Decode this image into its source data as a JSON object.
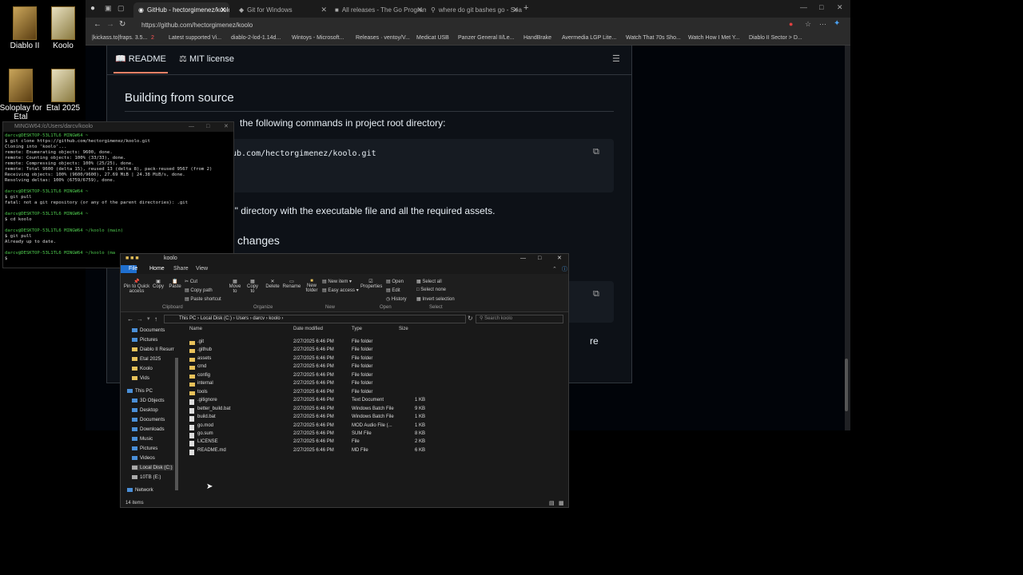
{
  "desktop": {
    "icons": [
      {
        "label": "Diablo II"
      },
      {
        "label": "Koolo"
      },
      {
        "label": "Soloplay for Etal"
      },
      {
        "label": "Etal 2025"
      }
    ]
  },
  "browser": {
    "tabs": [
      {
        "label": "GitHub - hectorgimenez/koolo: D"
      },
      {
        "label": "Git for Windows"
      },
      {
        "label": "All releases - The Go Programmi"
      },
      {
        "label": "where do git bashes go - Search"
      }
    ],
    "url": "https://github.com/hectorgimenez/koolo",
    "bookmarks": [
      {
        "label": "|kickass.to|fraps. 3.5..."
      },
      {
        "label": "2"
      },
      {
        "label": "Latest supported Vi..."
      },
      {
        "label": "diablo-2-lod-1.14d..."
      },
      {
        "label": "Wintoys - Microsoft..."
      },
      {
        "label": "Releases · ventoy/V..."
      },
      {
        "label": "Medicat USB"
      },
      {
        "label": "Panzer General II/Le..."
      },
      {
        "label": "HandBrake"
      },
      {
        "label": "Avermedia LGP Lite..."
      },
      {
        "label": "Watch That 70s Sho..."
      },
      {
        "label": "Watch How I Met Y..."
      },
      {
        "label": "Diablo II Sector > D..."
      }
    ],
    "readme_tab": "README",
    "license_tab": "MIT license",
    "heading1": "Building from source",
    "para1": "the following commands in project root directory:",
    "code1": "ub.com/hectorgimenez/koolo.git",
    "para2": "d\" directory with the executable file and all the required assets.",
    "heading2": "changes",
    "para3": "re"
  },
  "terminal": {
    "title": "MINGW64:/c/Users/darcv/koolo",
    "lines": [
      {
        "cls": "g",
        "text": "darcv@DESKTOP-53L1TL6 MINGW64 ~"
      },
      {
        "cls": "",
        "text": "$ git clone https://github.com/hectorgimenez/koolo.git"
      },
      {
        "cls": "",
        "text": "Cloning into 'koolo'..."
      },
      {
        "cls": "",
        "text": "remote: Enumerating objects: 9600, done."
      },
      {
        "cls": "",
        "text": "remote: Counting objects: 100% (33/33), done."
      },
      {
        "cls": "",
        "text": "remote: Compressing objects: 100% (25/25), done."
      },
      {
        "cls": "",
        "text": "remote: Total 9600 (delta 15), reused 13 (delta 8), pack-reused 9567 (from 2)"
      },
      {
        "cls": "",
        "text": "Receiving objects: 100% (9600/9600), 27.69 MiB | 24.38 MiB/s, done."
      },
      {
        "cls": "",
        "text": "Resolving deltas: 100% (6759/6759), done."
      },
      {
        "cls": "",
        "text": " "
      },
      {
        "cls": "g",
        "text": "darcv@DESKTOP-53L1TL6 MINGW64 ~"
      },
      {
        "cls": "",
        "text": "$ git pull"
      },
      {
        "cls": "",
        "text": "fatal: not a git repository (or any of the parent directories): .git"
      },
      {
        "cls": "",
        "text": " "
      },
      {
        "cls": "g",
        "text": "darcv@DESKTOP-53L1TL6 MINGW64 ~"
      },
      {
        "cls": "",
        "text": "$ cd koolo"
      },
      {
        "cls": "",
        "text": " "
      },
      {
        "cls": "g",
        "text": "darcv@DESKTOP-53L1TL6 MINGW64 ~/koolo (main)"
      },
      {
        "cls": "",
        "text": "$ git pull"
      },
      {
        "cls": "",
        "text": "Already up to date."
      },
      {
        "cls": "",
        "text": " "
      },
      {
        "cls": "g",
        "text": "darcv@DESKTOP-53L1TL6 MINGW64 ~/koolo (ma"
      },
      {
        "cls": "",
        "text": "$"
      }
    ]
  },
  "explorer": {
    "title": "koolo",
    "ribbon_tabs": [
      "File",
      "Home",
      "Share",
      "View"
    ],
    "ribbon": {
      "pin": "Pin to Quick access",
      "copy": "Copy",
      "paste": "Paste",
      "cut": "Cut",
      "copy_path": "Copy path",
      "paste_shortcut": "Paste shortcut",
      "move": "Move to",
      "copyto": "Copy to",
      "delete": "Delete",
      "rename": "Rename",
      "new_folder": "New folder",
      "new_item": "New item",
      "easy_access": "Easy access",
      "properties": "Properties",
      "open": "Open",
      "edit": "Edit",
      "history": "History",
      "select_all": "Select all",
      "select_none": "Select none",
      "invert": "Invert selection",
      "g_clipboard": "Clipboard",
      "g_organize": "Organize",
      "g_new": "New",
      "g_open": "Open",
      "g_select": "Select"
    },
    "breadcrumb": [
      "This PC",
      "Local Disk (C:)",
      "Users",
      "darcv",
      "koolo"
    ],
    "search_placeholder": "Search koolo",
    "nav": [
      {
        "label": "Documents"
      },
      {
        "label": "Pictures"
      },
      {
        "label": "Diablo II Resurr"
      },
      {
        "label": "Etal 2025"
      },
      {
        "label": "Koolo"
      },
      {
        "label": "Vids"
      },
      {
        "label": "This PC"
      },
      {
        "label": "3D Objects"
      },
      {
        "label": "Desktop"
      },
      {
        "label": "Documents"
      },
      {
        "label": "Downloads"
      },
      {
        "label": "Music"
      },
      {
        "label": "Pictures"
      },
      {
        "label": "Videos"
      },
      {
        "label": "Local Disk (C:)"
      },
      {
        "label": "10TB (E:)"
      },
      {
        "label": "Network"
      }
    ],
    "columns": {
      "name": "Name",
      "date": "Date modified",
      "type": "Type",
      "size": "Size"
    },
    "files": [
      {
        "name": ".git",
        "date": "2/27/2025 6:46 PM",
        "type": "File folder",
        "size": "",
        "folder": true
      },
      {
        "name": ".github",
        "date": "2/27/2025 6:46 PM",
        "type": "File folder",
        "size": "",
        "folder": true
      },
      {
        "name": "assets",
        "date": "2/27/2025 6:46 PM",
        "type": "File folder",
        "size": "",
        "folder": true
      },
      {
        "name": "cmd",
        "date": "2/27/2025 6:46 PM",
        "type": "File folder",
        "size": "",
        "folder": true
      },
      {
        "name": "config",
        "date": "2/27/2025 6:46 PM",
        "type": "File folder",
        "size": "",
        "folder": true
      },
      {
        "name": "internal",
        "date": "2/27/2025 6:46 PM",
        "type": "File folder",
        "size": "",
        "folder": true
      },
      {
        "name": "tools",
        "date": "2/27/2025 6:46 PM",
        "type": "File folder",
        "size": "",
        "folder": true
      },
      {
        "name": ".gitignore",
        "date": "2/27/2025 6:46 PM",
        "type": "Text Document",
        "size": "1 KB",
        "folder": false
      },
      {
        "name": "better_build.bat",
        "date": "2/27/2025 6:46 PM",
        "type": "Windows Batch File",
        "size": "9 KB",
        "folder": false
      },
      {
        "name": "build.bat",
        "date": "2/27/2025 6:46 PM",
        "type": "Windows Batch File",
        "size": "1 KB",
        "folder": false
      },
      {
        "name": "go.mod",
        "date": "2/27/2025 6:46 PM",
        "type": "MOD Audio File (...",
        "size": "1 KB",
        "folder": false
      },
      {
        "name": "go.sum",
        "date": "2/27/2025 6:46 PM",
        "type": "SUM File",
        "size": "8 KB",
        "folder": false
      },
      {
        "name": "LICENSE",
        "date": "2/27/2025 6:46 PM",
        "type": "File",
        "size": "2 KB",
        "folder": false
      },
      {
        "name": "README.md",
        "date": "2/27/2025 6:46 PM",
        "type": "MD File",
        "size": "6 KB",
        "folder": false
      }
    ],
    "status": "14 items"
  }
}
